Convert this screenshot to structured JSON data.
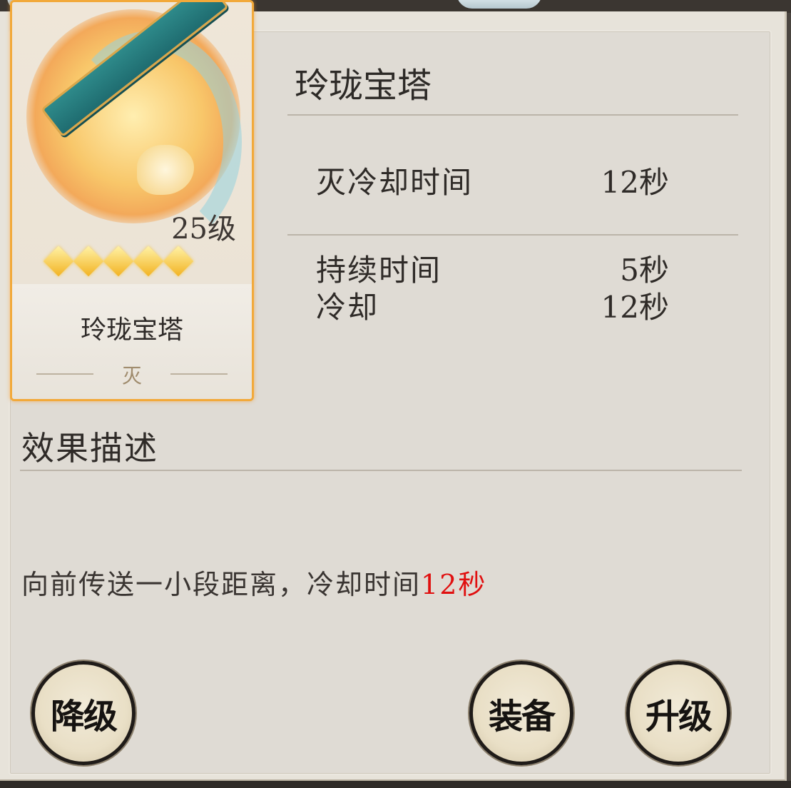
{
  "card": {
    "name": "玲珑宝塔",
    "level": "25级",
    "stars": 5,
    "type": "灭"
  },
  "info": {
    "title": "玲珑宝塔",
    "stats": [
      {
        "label": "灭冷却时间",
        "value": "12秒"
      },
      {
        "label": "持续时间",
        "value": "5秒"
      },
      {
        "label": "冷却",
        "value": "12秒"
      }
    ]
  },
  "effect": {
    "section_title": "效果描述",
    "text": "向前传送一小段距离，冷却时间",
    "highlight": "12秒",
    "highlight_color": "#e01010"
  },
  "buttons": {
    "downgrade": "降级",
    "equip": "装备",
    "upgrade": "升级"
  },
  "colors": {
    "card_border": "#f2a93a",
    "star": "#f2b322",
    "panel_bg": "#dfdbd4"
  }
}
